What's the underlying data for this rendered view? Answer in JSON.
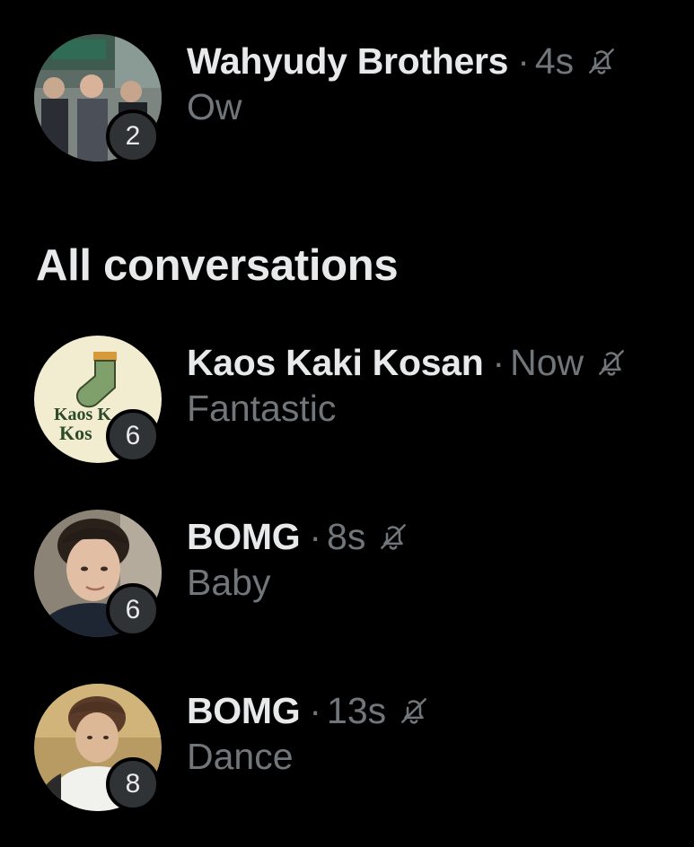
{
  "pinned": [
    {
      "name": "Wahyudy Brothers",
      "separator": "·",
      "time": "4s",
      "preview": "Ow",
      "unread_count": "2",
      "muted": true
    }
  ],
  "all_conversations": {
    "title": "All conversations",
    "items": [
      {
        "name": "Kaos Kaki Kosan",
        "separator": "·",
        "time": "Now",
        "preview": "Fantastic",
        "unread_count": "6",
        "muted": true,
        "avatar_text": [
          "Kaos K",
          "Kos"
        ]
      },
      {
        "name": "BOMG",
        "separator": "·",
        "time": "8s",
        "preview": "Baby",
        "unread_count": "6",
        "muted": true
      },
      {
        "name": "BOMG",
        "separator": "·",
        "time": "13s",
        "preview": "Dance",
        "unread_count": "8",
        "muted": true
      }
    ]
  },
  "colors": {
    "background": "#000000",
    "primary_text": "#e7e9ea",
    "secondary_text": "#71767b",
    "badge": "#2f3336"
  },
  "icons": {
    "muted": "bell-slash-icon"
  }
}
